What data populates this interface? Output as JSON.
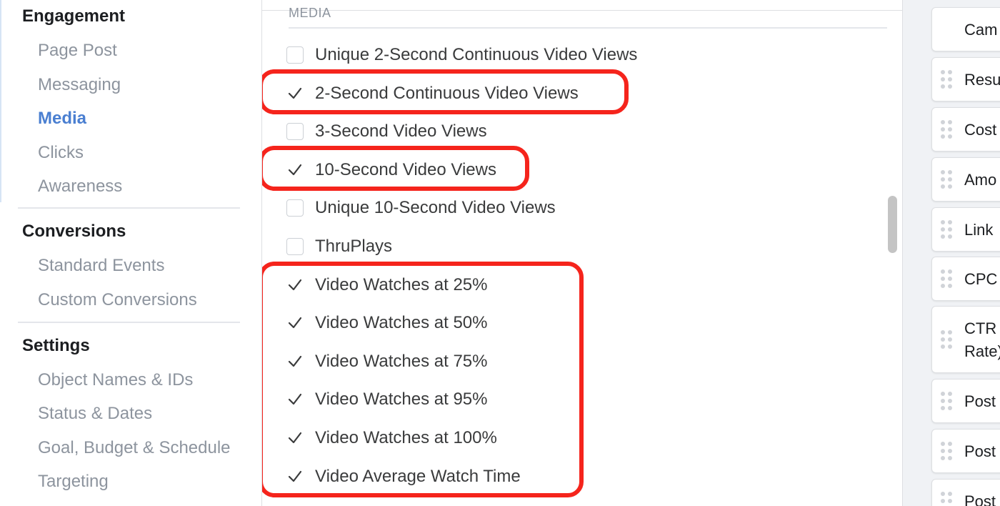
{
  "sidebar": {
    "sections": [
      {
        "heading": "Engagement",
        "items": [
          "Page Post",
          "Messaging",
          "Media",
          "Clicks",
          "Awareness"
        ]
      },
      {
        "heading": "Conversions",
        "items": [
          "Standard Events",
          "Custom Conversions"
        ]
      },
      {
        "heading": "Settings",
        "items": [
          "Object Names & IDs",
          "Status & Dates",
          "Goal, Budget & Schedule",
          "Targeting"
        ]
      }
    ],
    "active_item": "Media"
  },
  "checklist": {
    "section_label": "MEDIA",
    "items": [
      {
        "label": "Unique 2-Second Continuous Video Views",
        "checked": false
      },
      {
        "label": "2-Second Continuous Video Views",
        "checked": true
      },
      {
        "label": "3-Second Video Views",
        "checked": false
      },
      {
        "label": "10-Second Video Views",
        "checked": true
      },
      {
        "label": "Unique 10-Second Video Views",
        "checked": false
      },
      {
        "label": "ThruPlays",
        "checked": false
      },
      {
        "label": "Video Watches at 25%",
        "checked": true
      },
      {
        "label": "Video Watches at 50%",
        "checked": true
      },
      {
        "label": "Video Watches at 75%",
        "checked": true
      },
      {
        "label": "Video Watches at 95%",
        "checked": true
      },
      {
        "label": "Video Watches at 100%",
        "checked": true
      },
      {
        "label": "Video Average Watch Time",
        "checked": true
      }
    ]
  },
  "columns_panel": {
    "cards": [
      {
        "label": "Cam"
      },
      {
        "label": "Resu"
      },
      {
        "label": "Cost"
      },
      {
        "label": "Amo"
      },
      {
        "label": "Link"
      },
      {
        "label": "CPC"
      },
      {
        "label": "CTR",
        "label_line2": "Rate)"
      },
      {
        "label": "Post"
      },
      {
        "label": "Post"
      },
      {
        "label": "Post"
      }
    ]
  },
  "colors": {
    "highlight": "#f5241c",
    "active_nav": "#4a7fd1",
    "muted_text": "#8d949e"
  }
}
